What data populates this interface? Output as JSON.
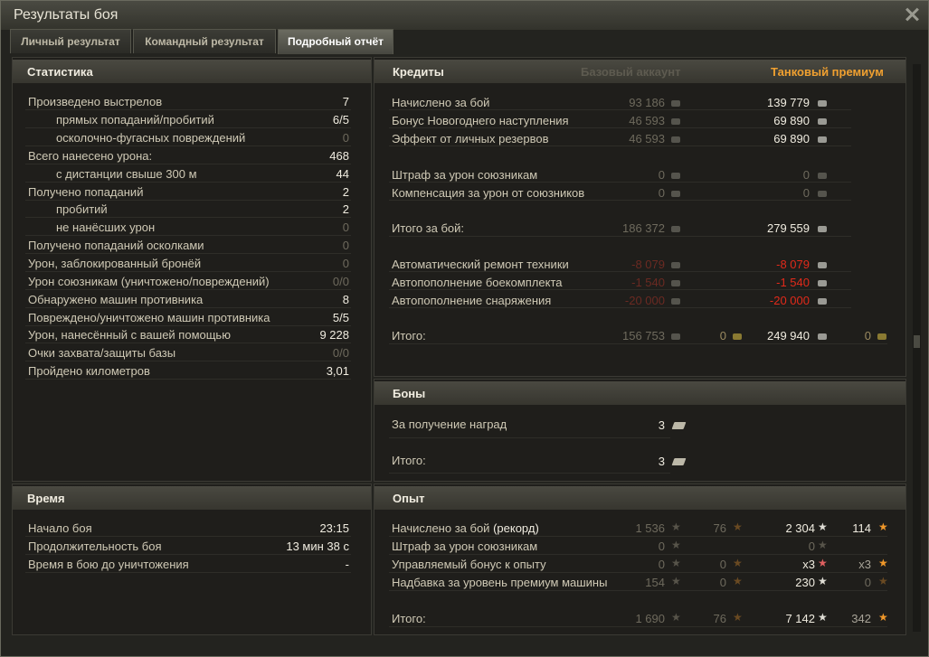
{
  "window": {
    "title": "Результаты боя"
  },
  "tabs": [
    "Личный результат",
    "Командный результат",
    "Подробный отчёт"
  ],
  "stats": {
    "title": "Статистика",
    "rows": [
      {
        "label": "Произведено выстрелов",
        "value": "7"
      },
      {
        "label": "прямых попаданий/пробитий",
        "value": "6/5"
      },
      {
        "label": "осколочно-фугасных повреждений",
        "value": "0"
      },
      {
        "label": "Всего нанесено урона:",
        "value": "468"
      },
      {
        "label": "с дистанции свыше 300 м",
        "value": "44"
      },
      {
        "label": "Получено попаданий",
        "value": "2"
      },
      {
        "label": "пробитий",
        "value": "2"
      },
      {
        "label": "не нанёсших урон",
        "value": "0"
      },
      {
        "label": "Получено попаданий осколками",
        "value": "0"
      },
      {
        "label": "Урон, заблокированный бронёй",
        "value": "0"
      },
      {
        "label": "Урон союзникам (уничтожено/повреждений)",
        "value": "0/0"
      },
      {
        "label": "Обнаружено машин противника",
        "value": "8"
      },
      {
        "label": "Повреждено/уничтожено машин противника",
        "value": "5/5"
      },
      {
        "label": "Урон, нанесённый с вашей помощью",
        "value": "9 228"
      },
      {
        "label": "Очки захвата/защиты базы",
        "value": "0/0"
      },
      {
        "label": "Пройдено километров",
        "value": "3,01"
      }
    ]
  },
  "time": {
    "title": "Время",
    "rows": [
      {
        "label": "Начало боя",
        "value": "23:15"
      },
      {
        "label": "Продолжительность боя",
        "value": "13 мин 38 с"
      },
      {
        "label": "Время в бою до уничтожения",
        "value": "-"
      }
    ]
  },
  "credits": {
    "title": "Кредиты",
    "col_base": "Базовый аккаунт",
    "col_premium": "Танковый премиум",
    "rows": [
      {
        "label": "Начислено за бой",
        "base": "93 186",
        "premium": "139 779"
      },
      {
        "label": "Бонус Новогоднего наступления",
        "base": "46 593",
        "premium": "69 890"
      },
      {
        "label": "Эффект от личных резервов",
        "base": "46 593",
        "premium": "69 890"
      },
      {
        "label": "Штраф за урон союзникам",
        "base": "0",
        "premium": "0"
      },
      {
        "label": "Компенсация за урон от союзников",
        "base": "0",
        "premium": "0"
      },
      {
        "label": "Итого за бой:",
        "base": "186 372",
        "premium": "279 559"
      },
      {
        "label": "Автоматический ремонт техники",
        "base": "-8 079",
        "premium": "-8 079"
      },
      {
        "label": "Автопополнение боекомплекта",
        "base": "-1 540",
        "premium": "-1 540"
      },
      {
        "label": "Автопополнение снаряжения",
        "base": "-20 000",
        "premium": "-20 000"
      },
      {
        "label": "Итого:",
        "base": "156 753",
        "base_gold": "0",
        "premium": "249 940",
        "premium_gold": "0"
      }
    ]
  },
  "bonds": {
    "title": "Боны",
    "rows": [
      {
        "label": "За получение наград",
        "value": "3"
      },
      {
        "label": "Итого:",
        "value": "3"
      }
    ]
  },
  "exp": {
    "title": "Опыт",
    "rows": [
      {
        "label": "Начислено за бой",
        "label_extra": "(рекорд)",
        "base": "1 536",
        "base_free": "76",
        "premium": "2 304",
        "premium_free": "114"
      },
      {
        "label": "Штраф за урон союзникам",
        "base": "0",
        "premium": "0"
      },
      {
        "label": "Управляемый бонус к опыту",
        "base": "0",
        "base_free": "0",
        "premium": "x3",
        "premium_free": "x3"
      },
      {
        "label": "Надбавка за уровень премиум машины",
        "base": "154",
        "base_free": "0",
        "premium": "230",
        "premium_free": "0"
      },
      {
        "label": "Итого:",
        "base": "1 690",
        "base_free": "76",
        "premium": "7 142",
        "premium_free": "342"
      }
    ]
  }
}
